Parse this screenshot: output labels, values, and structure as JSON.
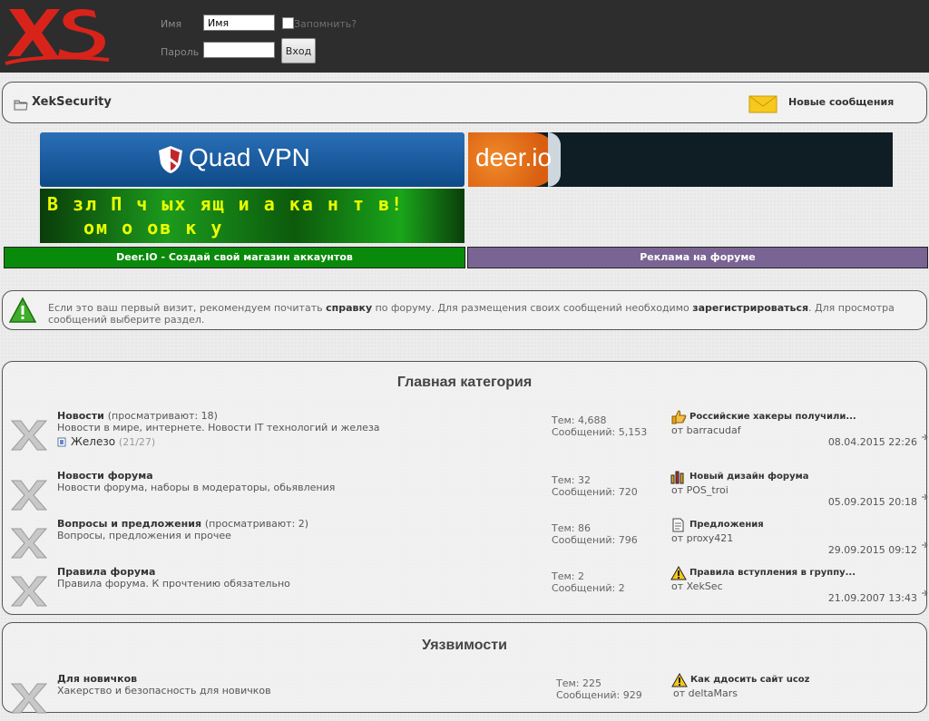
{
  "login": {
    "username_label": "Имя",
    "username_value": "Имя",
    "password_label": "Пароль",
    "remember_label": "Запомнить?",
    "submit_label": "Вход"
  },
  "nav": {
    "site_title": "XekSecurity",
    "new_messages": "Новые сообщения"
  },
  "banners": {
    "quad_vpn": "Quad VPN",
    "deer_io": "deer.io",
    "hack_text_line1": "В зл П ч ых ящ и а ка н т в!",
    "hack_text_line2": "ом о ов к у"
  },
  "ads": {
    "deer_label": "Deer.IO - Создай свой магазин аккаунтов",
    "forum_ad_label": "Реклама на форуме"
  },
  "notice": {
    "part1": "Если это ваш первый визит, рекомендуем почитать ",
    "help_link": "справку",
    "part2": " по форуму. Для размещения своих сообщений необходимо ",
    "register_link": "зарегистрироваться",
    "part3": ". Для просмотра сообщений выберите раздел."
  },
  "categories": [
    {
      "title": "Главная категория",
      "forums": [
        {
          "name": "Новости",
          "views": "(просматривают: 18)",
          "desc": "Новости в мире, интернете. Новости IT технологий и железа",
          "sub_name": "Железо",
          "sub_count": "(21/27)",
          "topics": "Тем: 4,688",
          "posts": "Сообщений: 5,153",
          "last_title": "Российские хакеры получили...",
          "last_by": "от barracudaf",
          "last_date": "08.04.2015 22:26",
          "last_icon": "thumbs-up-icon"
        },
        {
          "name": "Новости форума",
          "views": "",
          "desc": "Новости форума, наборы в модераторы, обьявления",
          "topics": "Тем: 32",
          "posts": "Сообщений: 720",
          "last_title": "Новый дизайн форума",
          "last_by": "от POS_troi",
          "last_date": "05.09.2015 20:18",
          "last_icon": "bar-chart-icon"
        },
        {
          "name": "Вопросы и предложения",
          "views": "(просматривают: 2)",
          "desc": "Вопросы, предложения и прочее",
          "topics": "Тем: 86",
          "posts": "Сообщений: 796",
          "last_title": "Предложения",
          "last_by": "от proxy421",
          "last_date": "29.09.2015 09:12",
          "last_icon": "document-icon"
        },
        {
          "name": "Правила форума",
          "views": "",
          "desc": "Правила форума. К прочтению обязательно",
          "topics": "Тем: 2",
          "posts": "Сообщений: 2",
          "last_title": "Правила вступления в группу...",
          "last_by": "от XekSec",
          "last_date": "21.09.2007 13:43",
          "last_icon": "warning-icon"
        }
      ]
    },
    {
      "title": "Уязвимости",
      "forums": [
        {
          "name": "Для новичков",
          "views": "",
          "desc": "Хакерство и безопасность для новичков",
          "topics": "Тем: 225",
          "posts": "Сообщений: 929",
          "last_title": "Как ддосить сайт ucoz",
          "last_by": "от deltaMars",
          "last_date": "",
          "last_icon": "warning-icon"
        }
      ]
    }
  ],
  "colors": {
    "header_bg": "#2d2d2d",
    "logo_red": "#d8231b",
    "ad_green": "#0a8a0a",
    "ad_purple": "#7a6494",
    "quad_blue": "#0e4a87",
    "deer_orange": "#e8741c"
  }
}
